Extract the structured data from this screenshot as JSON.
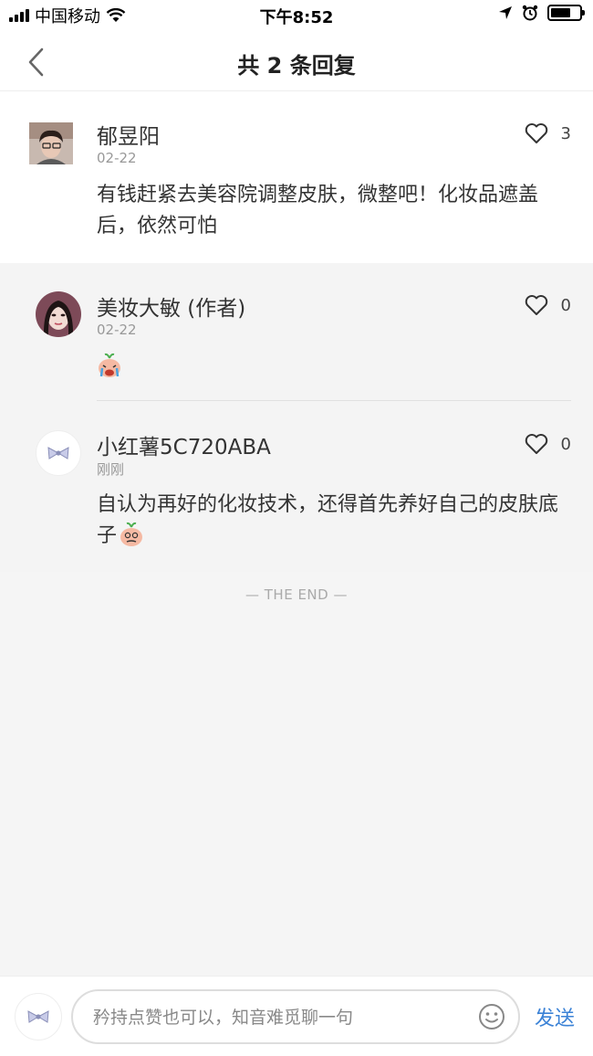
{
  "status_bar": {
    "carrier": "中国移动",
    "time": "下午8:52"
  },
  "header": {
    "title": "共 2 条回复"
  },
  "main_comment": {
    "username": "郁昱阳",
    "date": "02-22",
    "likes": "3",
    "text": "有钱赶紧去美容院调整皮肤，微整吧！化妆品遮盖后，依然可怕"
  },
  "replies": [
    {
      "username": "美妆大敏 (作者)",
      "date": "02-22",
      "likes": "0",
      "text": ""
    },
    {
      "username": "小红薯5C720ABA",
      "date": "刚刚",
      "likes": "0",
      "text": "自认为再好的化妆技术，还得首先养好自己的皮肤底子"
    }
  ],
  "end_marker": "— THE END —",
  "bottom_bar": {
    "placeholder": "矜持点赞也可以，知音难觅聊一句",
    "send_label": "发送"
  },
  "colors": {
    "accent": "#3b82d6",
    "reply_background": "#f4f4f4"
  }
}
